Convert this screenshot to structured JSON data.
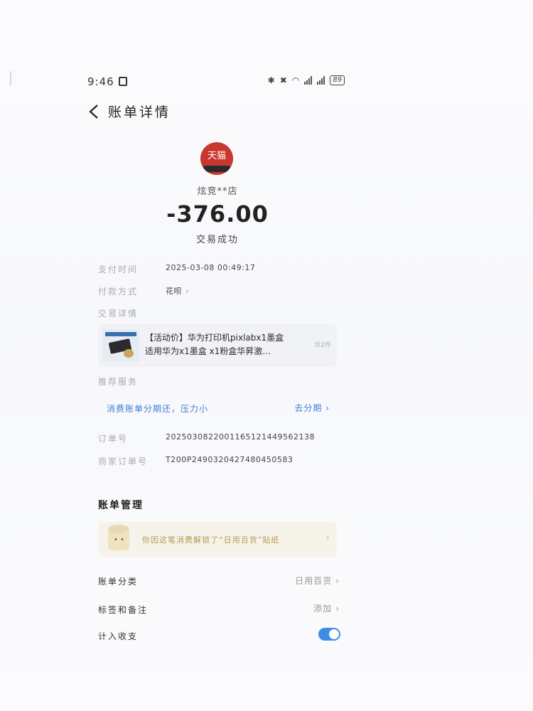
{
  "status_bar": {
    "time": "9:46",
    "battery": "89"
  },
  "nav": {
    "title": "账单详情"
  },
  "merchant": {
    "logo_text": "天猫",
    "name": "炫竞**店",
    "amount": "-376.00",
    "status": "交易成功"
  },
  "details": {
    "pay_time_label": "支付时间",
    "pay_time_value": "2025-03-08 00:49:17",
    "pay_method_label": "付款方式",
    "pay_method_value": "花呗",
    "trade_detail_label": "交易详情"
  },
  "product": {
    "title_line1": "【活动价】华为打印机pixlabx1墨盒",
    "title_line2": "适用华为x1墨盒 x1粉盒华昇激…",
    "count": "共2件"
  },
  "recommend": {
    "label": "推荐服务",
    "text": "消费账单分期还，压力小",
    "action": "去分期"
  },
  "order": {
    "order_no_label": "订单号",
    "order_no_value": "2025030822001165121449562138",
    "merchant_no_label": "商家订单号",
    "merchant_no_value": "T200P2490320427480450583"
  },
  "management": {
    "title": "账单管理",
    "sticker_text": "你因这笔消费解锁了“日用百货”贴纸",
    "category_label": "账单分类",
    "category_value": "日用百货",
    "tags_label": "标签和备注",
    "tags_value": "添加",
    "count_in_label": "计入收支",
    "count_in_enabled": true
  },
  "colors": {
    "accent": "#3b8de8",
    "amount": "#222222",
    "logo": "#c9382f"
  }
}
